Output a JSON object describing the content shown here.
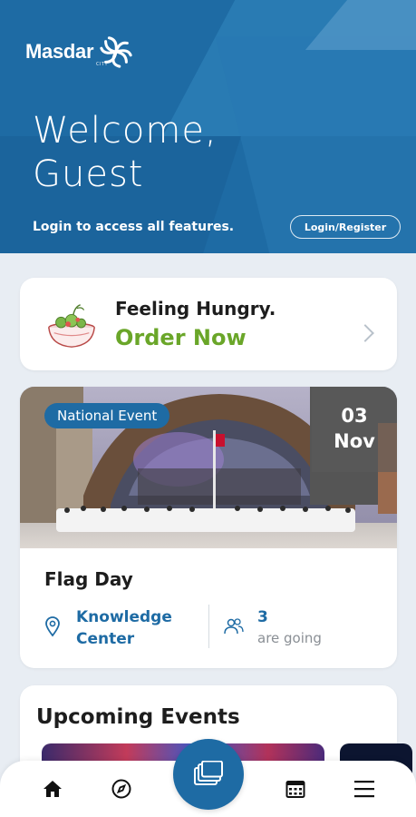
{
  "header": {
    "brand": "Masdar",
    "brand_sub": "CITY",
    "welcome_line1": "Welcome,",
    "welcome_line2": "Guest",
    "login_hint": "Login to access all features.",
    "login_button": "Login/Register"
  },
  "hungry_card": {
    "title": "Feeling Hungry.",
    "cta": "Order Now",
    "icon": "salad-bowl-icon",
    "accent": "#6aa629"
  },
  "featured_event": {
    "tag": "National Event",
    "day": "03",
    "month": "Nov",
    "title": "Flag Day",
    "location_line1": "Knowledge",
    "location_line2": "Center",
    "going_count": "3",
    "going_label": "are going"
  },
  "upcoming": {
    "heading": "Upcoming Events"
  },
  "bottom_nav": {
    "items": [
      "home-icon",
      "compass-icon",
      "cards-icon",
      "calendar-icon",
      "menu-icon"
    ]
  },
  "colors": {
    "primary": "#1e6ba4",
    "background": "#e8edf3"
  }
}
